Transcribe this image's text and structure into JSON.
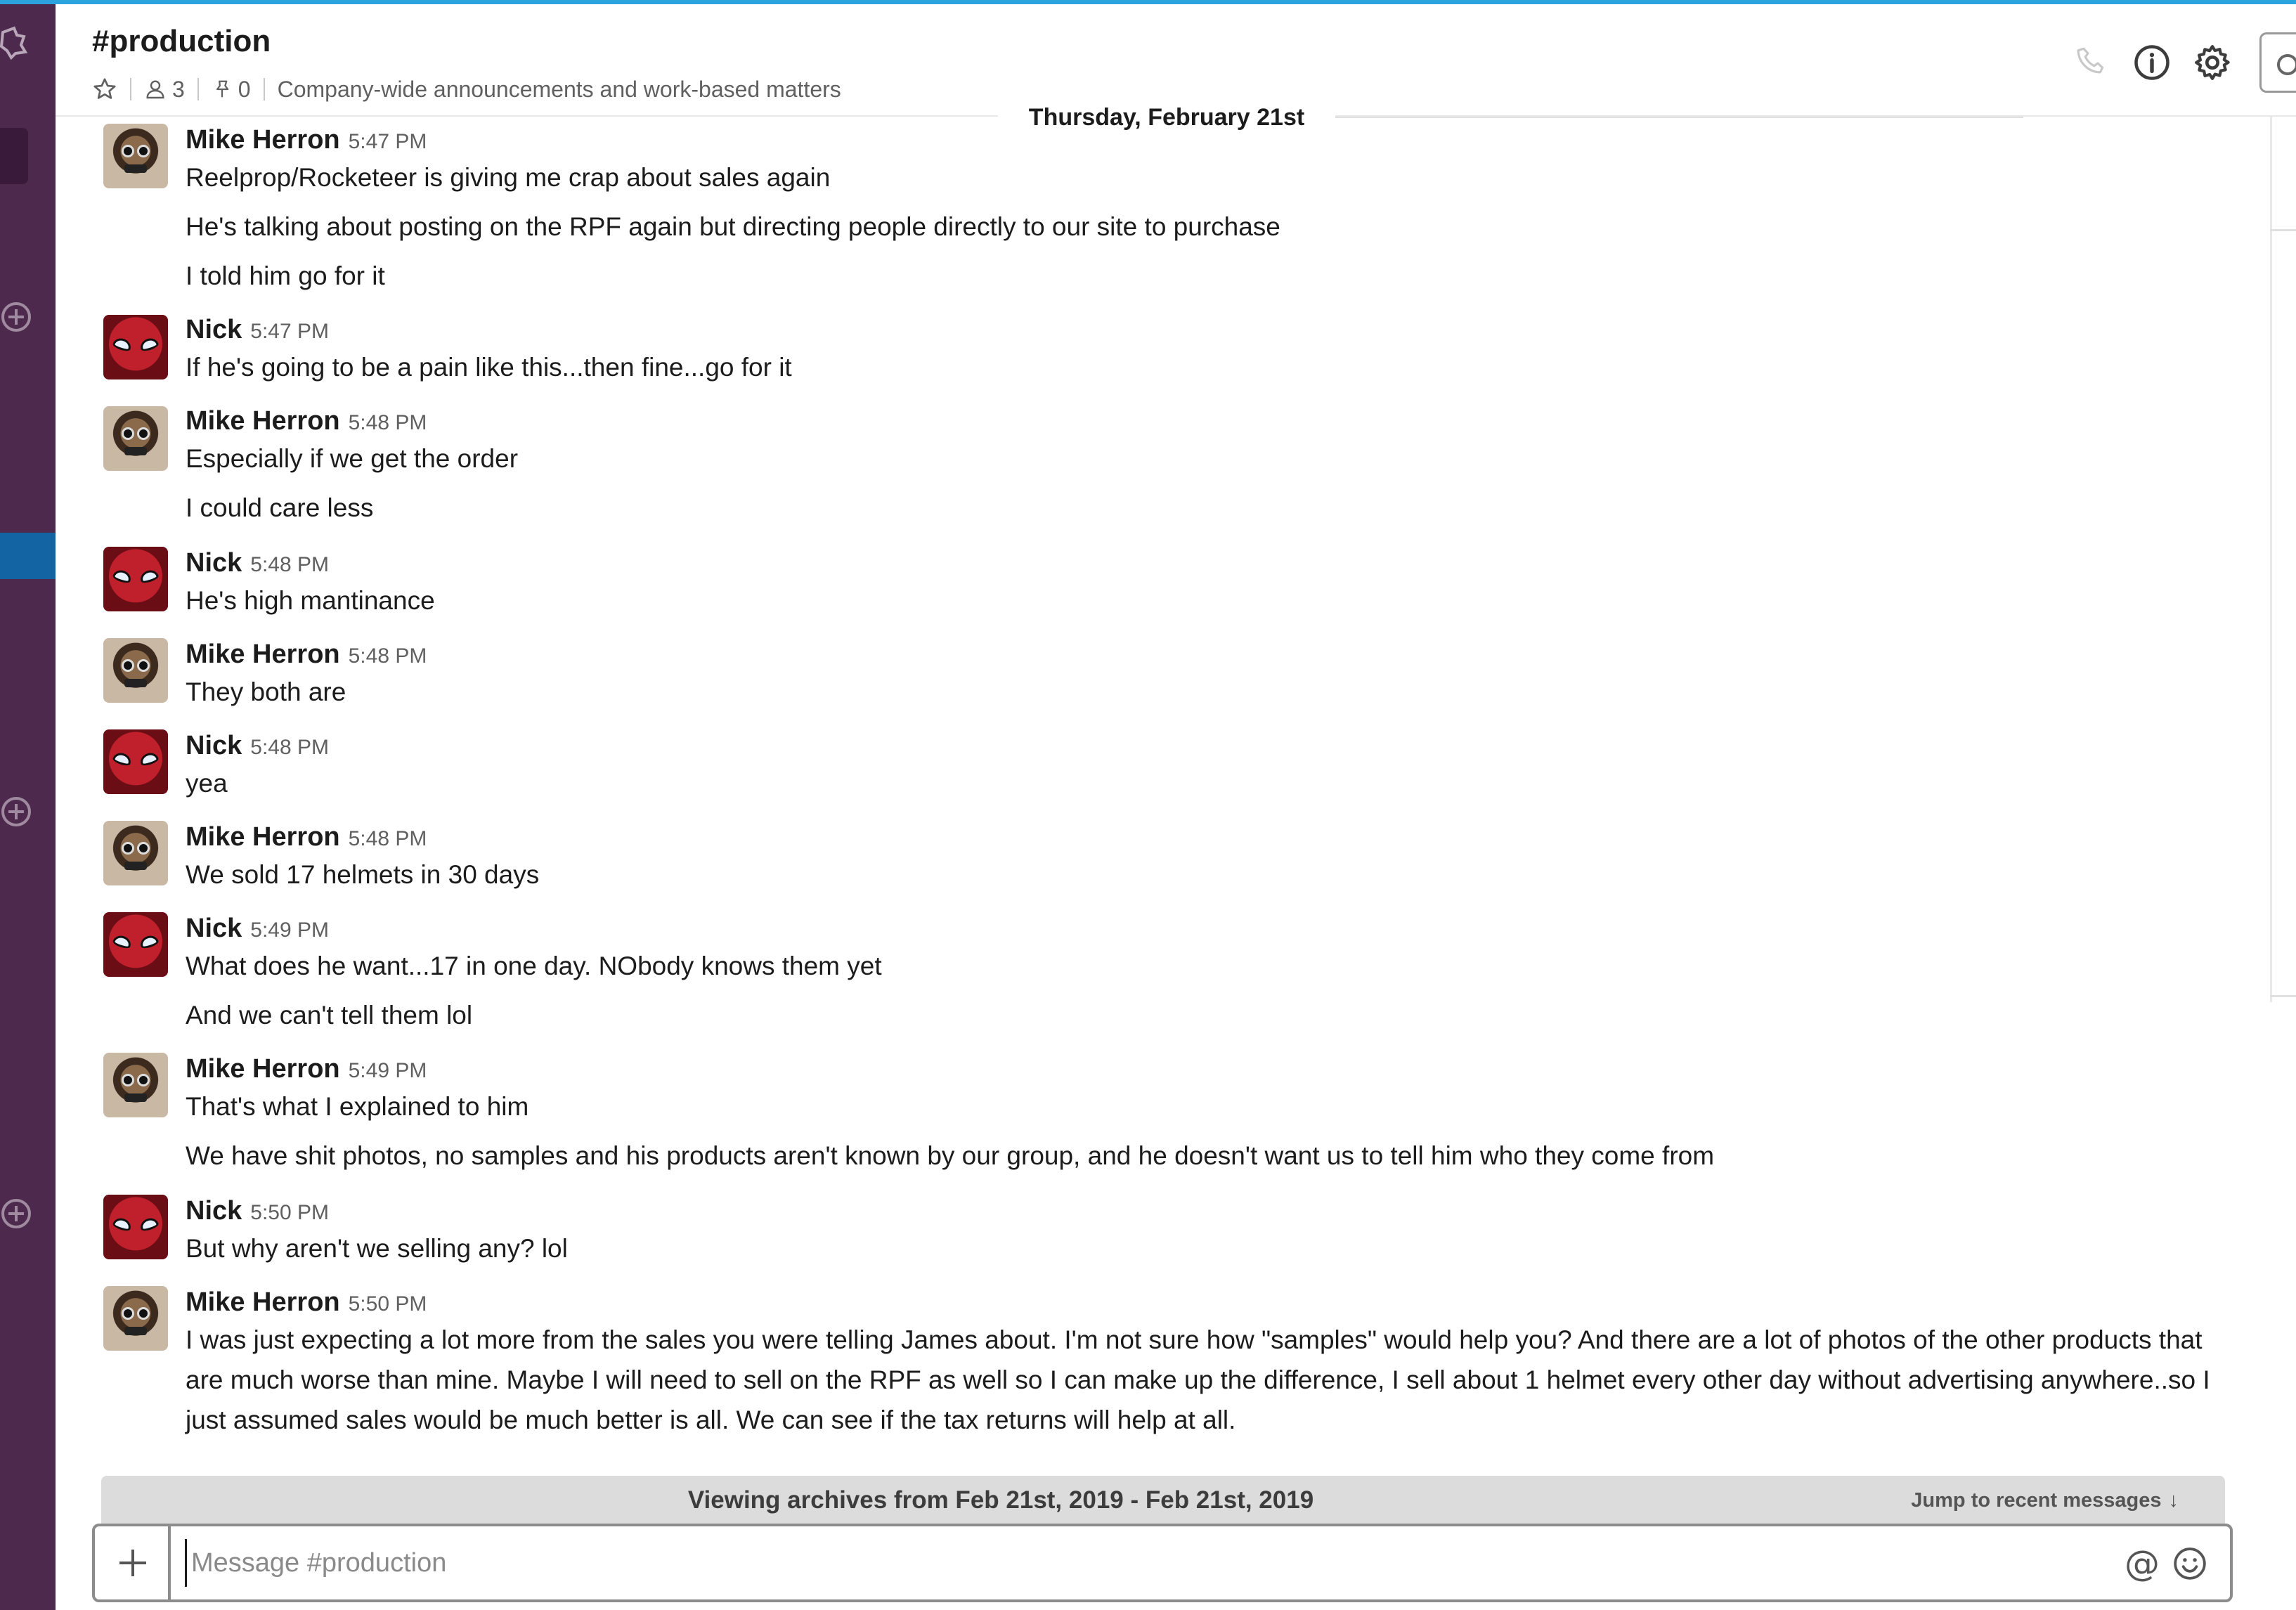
{
  "channel": {
    "name": "#production",
    "member_count": "3",
    "pinned_count": "0",
    "topic": "Company-wide announcements and work-based matters"
  },
  "date_divider": "Thursday, February 21st",
  "messages": [
    {
      "sender": "Mike Herron",
      "time": "5:47 PM",
      "avatar": "mike",
      "lines": [
        "Reelprop/Rocketeer is giving me crap about sales again",
        "He's talking about posting on the RPF again but directing people directly to our site to purchase",
        "I told him go for it"
      ]
    },
    {
      "sender": "Nick",
      "time": "5:47 PM",
      "avatar": "nick",
      "lines": [
        "If he's going to be a pain like this...then fine...go for it"
      ]
    },
    {
      "sender": "Mike Herron",
      "time": "5:48 PM",
      "avatar": "mike",
      "lines": [
        "Especially if we get the order",
        "I could care less"
      ]
    },
    {
      "sender": "Nick",
      "time": "5:48 PM",
      "avatar": "nick",
      "lines": [
        "He's high mantinance"
      ]
    },
    {
      "sender": "Mike Herron",
      "time": "5:48 PM",
      "avatar": "mike",
      "lines": [
        "They both are"
      ]
    },
    {
      "sender": "Nick",
      "time": "5:48 PM",
      "avatar": "nick",
      "lines": [
        "yea"
      ]
    },
    {
      "sender": "Mike Herron",
      "time": "5:48 PM",
      "avatar": "mike",
      "lines": [
        "We sold 17 helmets in 30 days"
      ]
    },
    {
      "sender": "Nick",
      "time": "5:49 PM",
      "avatar": "nick",
      "lines": [
        "What does he want...17 in one day. NObody knows them yet",
        "And we can't tell them lol"
      ]
    },
    {
      "sender": "Mike Herron",
      "time": "5:49 PM",
      "avatar": "mike",
      "lines": [
        "That's what I explained to him",
        "We have shit photos, no samples and his products aren't known by our group, and he doesn't want us to tell him who they come from"
      ]
    },
    {
      "sender": "Nick",
      "time": "5:50 PM",
      "avatar": "nick",
      "lines": [
        "But why aren't we selling any? lol"
      ]
    },
    {
      "sender": "Mike Herron",
      "time": "5:50 PM",
      "avatar": "mike",
      "lines": [
        "I was just expecting a lot more from the sales you were telling James about.  I'm not sure how \"samples\" would help you?  And there are a lot of photos of the other products that are much worse than mine.  Maybe I will need to sell on the RPF as well so I can make up the difference, I sell about 1 helmet every other day without advertising anywhere..so I just assumed sales would be much better is all. We can see if the tax returns will help at all."
      ]
    }
  ],
  "archive": {
    "text": "Viewing archives from Feb 21st, 2019 - Feb 21st, 2019",
    "jump_label": "Jump to recent messages",
    "jump_arrow": "↓"
  },
  "composer": {
    "placeholder": "Message #production",
    "value": ""
  },
  "icons": {
    "header": [
      "star-icon",
      "member-icon",
      "pin-icon",
      "phone-icon",
      "info-icon",
      "gear-icon",
      "search-icon"
    ],
    "composer": [
      "plus-icon",
      "at-icon",
      "emoji-icon"
    ]
  },
  "colors": {
    "sidebar": "#4d2a4d",
    "active_item": "#1264a3",
    "top_border": "#2aa3de",
    "archive_bar": "#dcdcdc"
  }
}
